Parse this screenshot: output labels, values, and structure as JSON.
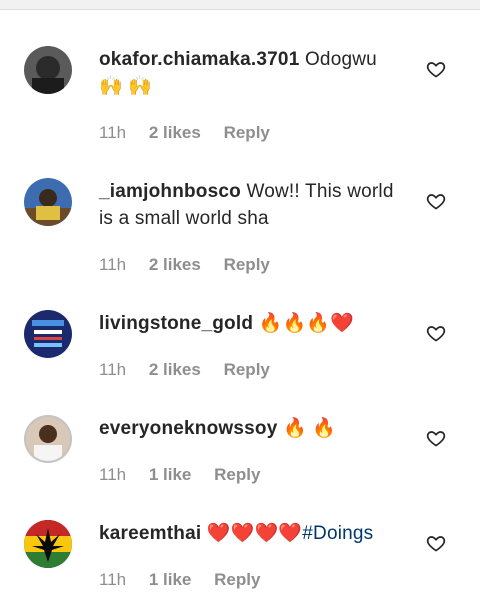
{
  "comments": [
    {
      "username": "okafor.chiamaka.3701",
      "text": "Odogwu 🙌 🙌",
      "hashtag": "",
      "time": "11h",
      "likes": "2 likes",
      "reply": "Reply"
    },
    {
      "username": "_iamjohnbosco",
      "text": "Wow!! This world is a small world sha",
      "hashtag": "",
      "time": "11h",
      "likes": "2 likes",
      "reply": "Reply"
    },
    {
      "username": "livingstone_gold",
      "text": "🔥🔥🔥❤️",
      "hashtag": "",
      "time": "11h",
      "likes": "2 likes",
      "reply": "Reply"
    },
    {
      "username": "everyoneknowssoy",
      "text": "🔥 🔥",
      "hashtag": "",
      "time": "11h",
      "likes": "1 like",
      "reply": "Reply"
    },
    {
      "username": "kareemthai",
      "text": "❤️❤️❤️❤️",
      "hashtag": "#Doings",
      "time": "11h",
      "likes": "1 like",
      "reply": "Reply"
    }
  ],
  "icons": {
    "like": "heart-outline-icon"
  },
  "colors": {
    "hashtag": "#00376b",
    "meta": "#8e8e8e"
  }
}
